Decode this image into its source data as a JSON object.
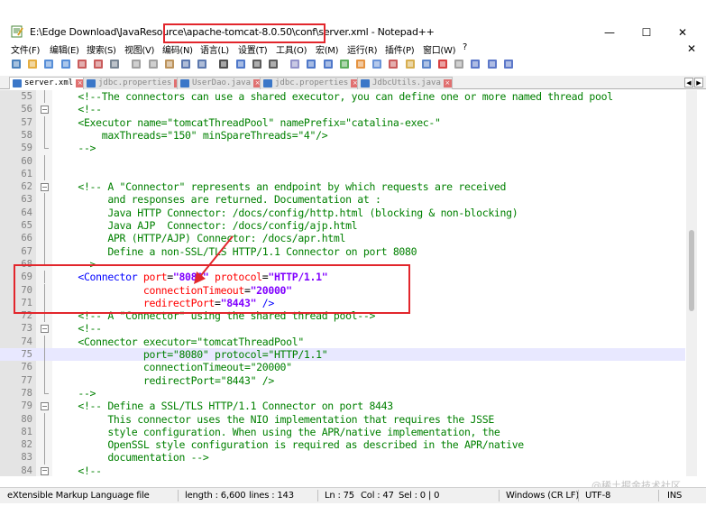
{
  "window": {
    "title": "E:\\Edge Download\\JavaResource\\apache-tomcat-8.0.50\\conf\\server.xml - Notepad++",
    "minimize": "—",
    "maximize": "☐",
    "close": "✕"
  },
  "menu": [
    "文件(F)",
    "编辑(E)",
    "搜索(S)",
    "视图(V)",
    "编码(N)",
    "语言(L)",
    "设置(T)",
    "工具(O)",
    "宏(M)",
    "运行(R)",
    "插件(P)",
    "窗口(W)",
    "?"
  ],
  "menu_close": "✕",
  "toolbar_icons": [
    "new-file-icon",
    "open-file-icon",
    "save-icon",
    "save-all-icon",
    "close-icon",
    "close-all-icon",
    "print-icon",
    "cut-icon",
    "copy-icon",
    "paste-icon",
    "undo-icon",
    "redo-icon",
    "find-icon",
    "replace-icon",
    "zoom-in-icon",
    "zoom-out-icon",
    "sync-scroll-icon",
    "word-wrap-icon",
    "show-all-chars-icon",
    "indent-guide-icon",
    "user-lang-icon",
    "doc-map-icon",
    "function-list-icon",
    "folder-workspace-icon",
    "monitor-icon",
    "record-macro-icon",
    "stop-macro-icon",
    "play-macro-icon",
    "run-macro-multiple-icon",
    "save-macro-icon"
  ],
  "tabs": [
    {
      "label": "server.xml",
      "active": true
    },
    {
      "label": "jdbc.properties",
      "active": false
    },
    {
      "label": "UserDao.java",
      "active": false
    },
    {
      "label": "jdbc.properties",
      "active": false
    },
    {
      "label": "JdbcUtils.java",
      "active": false
    }
  ],
  "tab_nav": {
    "prev": "◀",
    "next": "▶"
  },
  "lines": [
    {
      "num": "55",
      "fold": "vline",
      "current": false,
      "segs": [
        [
          "c-comment",
          "    <!--The connectors can use a shared executor, you can define one or more named thread pool"
        ]
      ]
    },
    {
      "num": "56",
      "fold": "box",
      "current": false,
      "segs": [
        [
          "c-comment",
          "    <!--"
        ]
      ]
    },
    {
      "num": "57",
      "fold": "vline",
      "current": false,
      "segs": [
        [
          "c-comment",
          "    <Executor name=\"tomcatThreadPool\" namePrefix=\"catalina-exec-\""
        ]
      ]
    },
    {
      "num": "58",
      "fold": "vline",
      "current": false,
      "segs": [
        [
          "c-comment",
          "        maxThreads=\"150\" minSpareThreads=\"4\"/>"
        ]
      ]
    },
    {
      "num": "59",
      "fold": "end",
      "current": false,
      "segs": [
        [
          "c-comment",
          "    -->"
        ]
      ]
    },
    {
      "num": "60",
      "fold": "vline",
      "current": false,
      "segs": []
    },
    {
      "num": "61",
      "fold": "vline",
      "current": false,
      "segs": []
    },
    {
      "num": "62",
      "fold": "box",
      "current": false,
      "segs": [
        [
          "c-comment",
          "    <!-- A \"Connector\" represents an endpoint by which requests are received"
        ]
      ]
    },
    {
      "num": "63",
      "fold": "vline",
      "current": false,
      "segs": [
        [
          "c-comment",
          "         and responses are returned. Documentation at :"
        ]
      ]
    },
    {
      "num": "64",
      "fold": "vline",
      "current": false,
      "segs": [
        [
          "c-comment",
          "         Java HTTP Connector: /docs/config/http.html (blocking & non-blocking)"
        ]
      ]
    },
    {
      "num": "65",
      "fold": "vline",
      "current": false,
      "segs": [
        [
          "c-comment",
          "         Java AJP  Connector: /docs/config/ajp.html"
        ]
      ]
    },
    {
      "num": "66",
      "fold": "vline",
      "current": false,
      "segs": [
        [
          "c-comment",
          "         APR (HTTP/AJP) Connector: /docs/apr.html"
        ]
      ]
    },
    {
      "num": "67",
      "fold": "vline",
      "current": false,
      "segs": [
        [
          "c-comment",
          "         Define a non-SSL/TLS HTTP/1.1 Connector on port 8080"
        ]
      ]
    },
    {
      "num": "68",
      "fold": "end",
      "current": false,
      "segs": [
        [
          "c-comment",
          "    -->"
        ]
      ]
    },
    {
      "num": "69",
      "fold": "vline",
      "current": false,
      "segs": [
        [
          "c-tag",
          "    <Connector "
        ],
        [
          "c-attr",
          "port"
        ],
        [
          "c-plain",
          "="
        ],
        [
          "c-val",
          "\"8080\""
        ],
        [
          "c-attr",
          " protocol"
        ],
        [
          "c-plain",
          "="
        ],
        [
          "c-val",
          "\"HTTP/1.1\""
        ]
      ]
    },
    {
      "num": "70",
      "fold": "vline",
      "current": false,
      "segs": [
        [
          "c-attr",
          "               connectionTimeout"
        ],
        [
          "c-plain",
          "="
        ],
        [
          "c-val",
          "\"20000\""
        ]
      ]
    },
    {
      "num": "71",
      "fold": "vline",
      "current": false,
      "segs": [
        [
          "c-attr",
          "               redirectPort"
        ],
        [
          "c-plain",
          "="
        ],
        [
          "c-val",
          "\"8443\""
        ],
        [
          "c-tag",
          " />"
        ]
      ]
    },
    {
      "num": "72",
      "fold": "vline",
      "current": false,
      "segs": [
        [
          "c-comment",
          "    <!-- A \"Connector\" using the shared thread pool-->"
        ]
      ]
    },
    {
      "num": "73",
      "fold": "box",
      "current": false,
      "segs": [
        [
          "c-comment",
          "    <!--"
        ]
      ]
    },
    {
      "num": "74",
      "fold": "vline",
      "current": false,
      "segs": [
        [
          "c-comment",
          "    <Connector executor=\"tomcatThreadPool\""
        ]
      ]
    },
    {
      "num": "75",
      "fold": "vline",
      "current": true,
      "segs": [
        [
          "c-comment",
          "               port=\"8080\" protocol=\"HTTP/1.1\""
        ]
      ]
    },
    {
      "num": "76",
      "fold": "vline",
      "current": false,
      "segs": [
        [
          "c-comment",
          "               connectionTimeout=\"20000\""
        ]
      ]
    },
    {
      "num": "77",
      "fold": "vline",
      "current": false,
      "segs": [
        [
          "c-comment",
          "               redirectPort=\"8443\" />"
        ]
      ]
    },
    {
      "num": "78",
      "fold": "end",
      "current": false,
      "segs": [
        [
          "c-comment",
          "    -->"
        ]
      ]
    },
    {
      "num": "79",
      "fold": "box",
      "current": false,
      "segs": [
        [
          "c-comment",
          "    <!-- Define a SSL/TLS HTTP/1.1 Connector on port 8443"
        ]
      ]
    },
    {
      "num": "80",
      "fold": "vline",
      "current": false,
      "segs": [
        [
          "c-comment",
          "         This connector uses the NIO implementation that requires the JSSE"
        ]
      ]
    },
    {
      "num": "81",
      "fold": "vline",
      "current": false,
      "segs": [
        [
          "c-comment",
          "         style configuration. When using the APR/native implementation, the"
        ]
      ]
    },
    {
      "num": "82",
      "fold": "vline",
      "current": false,
      "segs": [
        [
          "c-comment",
          "         OpenSSL style configuration is required as described in the APR/native"
        ]
      ]
    },
    {
      "num": "83",
      "fold": "vline",
      "current": false,
      "segs": [
        [
          "c-comment",
          "         documentation -->"
        ]
      ]
    },
    {
      "num": "84",
      "fold": "box",
      "current": false,
      "segs": [
        [
          "c-comment",
          "    <!--"
        ]
      ]
    }
  ],
  "watermark": "@稀土掘金技术社区",
  "status": {
    "language": "eXtensible Markup Language file",
    "length": "length : 6,600",
    "lines": "lines : 143",
    "ln": "Ln : 75",
    "col": "Col : 47",
    "sel": "Sel : 0 | 0",
    "eol": "Windows (CR LF)",
    "encoding": "UTF-8",
    "mode": "INS"
  },
  "colors": {
    "highlight": "#e2262c",
    "comment": "#008000",
    "tag": "#0000ff",
    "attr": "#ff0000",
    "value": "#8000ff"
  }
}
